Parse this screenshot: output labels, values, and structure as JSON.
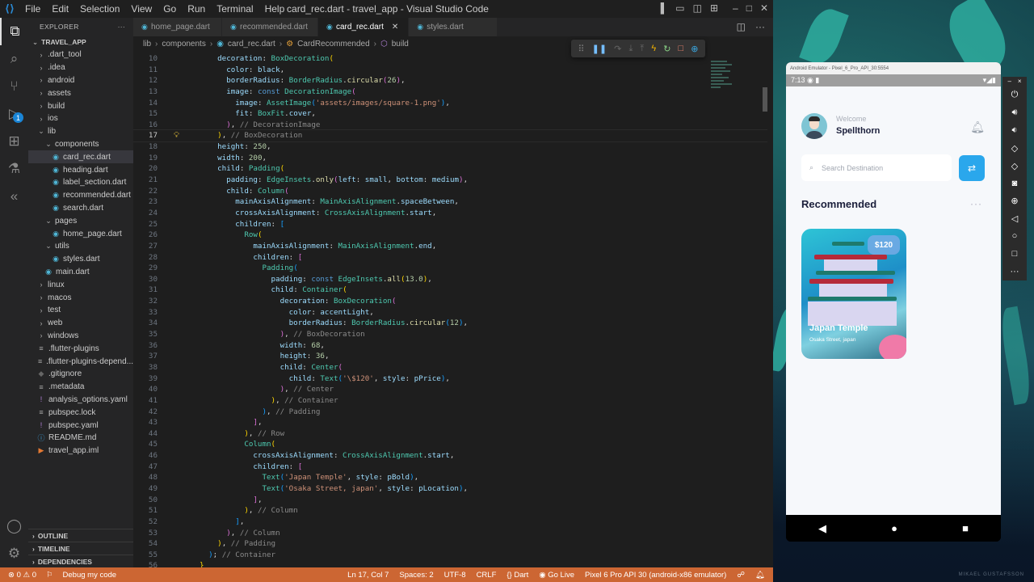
{
  "window": {
    "title": "card_rec.dart - travel_app - Visual Studio Code",
    "menu": [
      "File",
      "Edit",
      "Selection",
      "View",
      "Go",
      "Run",
      "Terminal",
      "Help"
    ]
  },
  "activity_bar": {
    "items": [
      "explorer-icon",
      "search-icon",
      "source-control-icon",
      "run-debug-icon",
      "extensions-icon",
      "testing-icon",
      "flutter-icon"
    ],
    "debug_badge": "1",
    "bottom": [
      "account-icon",
      "manage-gear-icon"
    ]
  },
  "sidebar": {
    "header": "EXPLORER",
    "more": "···",
    "root": "TRAVEL_APP",
    "items": [
      {
        "label": ".dart_tool",
        "type": "folder",
        "depth": 1
      },
      {
        "label": ".idea",
        "type": "folder",
        "depth": 1
      },
      {
        "label": "android",
        "type": "folder",
        "depth": 1
      },
      {
        "label": "assets",
        "type": "folder",
        "depth": 1
      },
      {
        "label": "build",
        "type": "folder",
        "depth": 1
      },
      {
        "label": "ios",
        "type": "folder",
        "depth": 1
      },
      {
        "label": "lib",
        "type": "folder-open",
        "depth": 1
      },
      {
        "label": "components",
        "type": "folder-open",
        "depth": 2
      },
      {
        "label": "card_rec.dart",
        "type": "dart",
        "depth": 3,
        "selected": true
      },
      {
        "label": "heading.dart",
        "type": "dart",
        "depth": 3
      },
      {
        "label": "label_section.dart",
        "type": "dart",
        "depth": 3
      },
      {
        "label": "recommended.dart",
        "type": "dart",
        "depth": 3
      },
      {
        "label": "search.dart",
        "type": "dart",
        "depth": 3
      },
      {
        "label": "pages",
        "type": "folder-open",
        "depth": 2
      },
      {
        "label": "home_page.dart",
        "type": "dart",
        "depth": 3
      },
      {
        "label": "utils",
        "type": "folder-open",
        "depth": 2
      },
      {
        "label": "styles.dart",
        "type": "dart",
        "depth": 3
      },
      {
        "label": "main.dart",
        "type": "dart",
        "depth": 2
      },
      {
        "label": "linux",
        "type": "folder",
        "depth": 1
      },
      {
        "label": "macos",
        "type": "folder",
        "depth": 1
      },
      {
        "label": "test",
        "type": "folder",
        "depth": 1
      },
      {
        "label": "web",
        "type": "folder",
        "depth": 1
      },
      {
        "label": "windows",
        "type": "folder",
        "depth": 1
      },
      {
        "label": ".flutter-plugins",
        "type": "lines",
        "depth": 1
      },
      {
        "label": ".flutter-plugins-depend...",
        "type": "lines",
        "depth": 1
      },
      {
        "label": ".gitignore",
        "type": "git",
        "depth": 1
      },
      {
        "label": ".metadata",
        "type": "lines",
        "depth": 1
      },
      {
        "label": "analysis_options.yaml",
        "type": "yaml",
        "depth": 1
      },
      {
        "label": "pubspec.lock",
        "type": "lines",
        "depth": 1
      },
      {
        "label": "pubspec.yaml",
        "type": "yaml",
        "depth": 1
      },
      {
        "label": "README.md",
        "type": "info",
        "depth": 1
      },
      {
        "label": "travel_app.iml",
        "type": "iml",
        "depth": 1
      }
    ],
    "sections": [
      "OUTLINE",
      "TIMELINE",
      "DEPENDENCIES"
    ]
  },
  "tabs": [
    {
      "label": "home_page.dart",
      "active": false
    },
    {
      "label": "recommended.dart",
      "active": false
    },
    {
      "label": "card_rec.dart",
      "active": true
    },
    {
      "label": "styles.dart",
      "active": false
    }
  ],
  "breadcrumb": [
    "lib",
    "components",
    "card_rec.dart",
    "CardRecommended",
    "build"
  ],
  "debug_toolbar": [
    "drag-handle",
    "pause",
    "step-over",
    "step-into",
    "step-out",
    "hot-reload",
    "hot-restart",
    "stop",
    "devtools"
  ],
  "editor": {
    "current_line": 17,
    "lines": [
      {
        "n": 10,
        "html": "    <span class='k'>decoration</span><span class='p'>: </span><span class='c'>BoxDecoration</span><span class='b1'>(</span>"
      },
      {
        "n": 11,
        "html": "      <span class='k'>color</span><span class='p'>: </span><span class='k'>black</span><span class='p'>,</span>"
      },
      {
        "n": 12,
        "html": "      <span class='k'>borderRadius</span><span class='p'>: </span><span class='c'>BorderRadius</span><span class='p'>.</span><span class='m'>circular</span><span class='b2'>(</span><span class='n'>26</span><span class='b2'>)</span><span class='p'>,</span>"
      },
      {
        "n": 13,
        "html": "      <span class='k'>image</span><span class='p'>: </span><span class='kw'>const</span> <span class='c'>DecorationImage</span><span class='b2'>(</span>"
      },
      {
        "n": 14,
        "html": "        <span class='k'>image</span><span class='p'>: </span><span class='c'>AssetImage</span><span class='b3'>(</span><span class='s'>'assets/images/square-1.png'</span><span class='b3'>)</span><span class='p'>,</span>"
      },
      {
        "n": 15,
        "html": "        <span class='k'>fit</span><span class='p'>: </span><span class='c'>BoxFit</span><span class='p'>.</span><span class='k'>cover</span><span class='p'>,</span>"
      },
      {
        "n": 16,
        "html": "      <span class='b2'>)</span><span class='p'>, </span><span class='cm'>// DecorationImage</span>"
      },
      {
        "n": 17,
        "html": "    <span class='b1'>)</span><span class='p'>, </span><span class='cm'>// BoxDecoration</span>"
      },
      {
        "n": 18,
        "html": "    <span class='k'>height</span><span class='p'>: </span><span class='n'>250</span><span class='p'>,</span>"
      },
      {
        "n": 19,
        "html": "    <span class='k'>width</span><span class='p'>: </span><span class='n'>200</span><span class='p'>,</span>"
      },
      {
        "n": 20,
        "html": "    <span class='k'>child</span><span class='p'>: </span><span class='c'>Padding</span><span class='b1'>(</span>"
      },
      {
        "n": 21,
        "html": "      <span class='k'>padding</span><span class='p'>: </span><span class='c'>EdgeInsets</span><span class='p'>.</span><span class='m'>only</span><span class='b2'>(</span><span class='k'>left</span><span class='p'>: </span><span class='k'>small</span><span class='p'>, </span><span class='k'>bottom</span><span class='p'>: </span><span class='k'>medium</span><span class='b2'>)</span><span class='p'>,</span>"
      },
      {
        "n": 22,
        "html": "      <span class='k'>child</span><span class='p'>: </span><span class='c'>Column</span><span class='b2'>(</span>"
      },
      {
        "n": 23,
        "html": "        <span class='k'>mainAxisAlignment</span><span class='p'>: </span><span class='c'>MainAxisAlignment</span><span class='p'>.</span><span class='k'>spaceBetween</span><span class='p'>,</span>"
      },
      {
        "n": 24,
        "html": "        <span class='k'>crossAxisAlignment</span><span class='p'>: </span><span class='c'>CrossAxisAlignment</span><span class='p'>.</span><span class='k'>start</span><span class='p'>,</span>"
      },
      {
        "n": 25,
        "html": "        <span class='k'>children</span><span class='p'>: </span><span class='b3'>[</span>"
      },
      {
        "n": 26,
        "html": "          <span class='c'>Row</span><span class='b1'>(</span>"
      },
      {
        "n": 27,
        "html": "            <span class='k'>mainAxisAlignment</span><span class='p'>: </span><span class='c'>MainAxisAlignment</span><span class='p'>.</span><span class='k'>end</span><span class='p'>,</span>"
      },
      {
        "n": 28,
        "html": "            <span class='k'>children</span><span class='p'>: </span><span class='b2'>[</span>"
      },
      {
        "n": 29,
        "html": "              <span class='c'>Padding</span><span class='b3'>(</span>"
      },
      {
        "n": 30,
        "html": "                <span class='k'>padding</span><span class='p'>: </span><span class='kw'>const</span> <span class='c'>EdgeInsets</span><span class='p'>.</span><span class='m'>all</span><span class='b1'>(</span><span class='n'>13.0</span><span class='b1'>)</span><span class='p'>,</span>"
      },
      {
        "n": 31,
        "html": "                <span class='k'>child</span><span class='p'>: </span><span class='c'>Container</span><span class='b1'>(</span>"
      },
      {
        "n": 32,
        "html": "                  <span class='k'>decoration</span><span class='p'>: </span><span class='c'>BoxDecoration</span><span class='b2'>(</span>"
      },
      {
        "n": 33,
        "html": "                    <span class='k'>color</span><span class='p'>: </span><span class='k'>accentLight</span><span class='p'>,</span>"
      },
      {
        "n": 34,
        "html": "                    <span class='k'>borderRadius</span><span class='p'>: </span><span class='c'>BorderRadius</span><span class='p'>.</span><span class='m'>circular</span><span class='b3'>(</span><span class='n'>12</span><span class='b3'>)</span><span class='p'>,</span>"
      },
      {
        "n": 35,
        "html": "                  <span class='b2'>)</span><span class='p'>, </span><span class='cm'>// BoxDecoration</span>"
      },
      {
        "n": 36,
        "html": "                  <span class='k'>width</span><span class='p'>: </span><span class='n'>68</span><span class='p'>,</span>"
      },
      {
        "n": 37,
        "html": "                  <span class='k'>height</span><span class='p'>: </span><span class='n'>36</span><span class='p'>,</span>"
      },
      {
        "n": 38,
        "html": "                  <span class='k'>child</span><span class='p'>: </span><span class='c'>Center</span><span class='b2'>(</span>"
      },
      {
        "n": 39,
        "html": "                    <span class='k'>child</span><span class='p'>: </span><span class='c'>Text</span><span class='b3'>(</span><span class='s'>'\\$120'</span><span class='p'>, </span><span class='k'>style</span><span class='p'>: </span><span class='k'>pPrice</span><span class='b3'>)</span><span class='p'>,</span>"
      },
      {
        "n": 40,
        "html": "                  <span class='b2'>)</span><span class='p'>, </span><span class='cm'>// Center</span>"
      },
      {
        "n": 41,
        "html": "                <span class='b1'>)</span><span class='p'>, </span><span class='cm'>// Container</span>"
      },
      {
        "n": 42,
        "html": "              <span class='b3'>)</span><span class='p'>, </span><span class='cm'>// Padding</span>"
      },
      {
        "n": 43,
        "html": "            <span class='b2'>]</span><span class='p'>,</span>"
      },
      {
        "n": 44,
        "html": "          <span class='b1'>)</span><span class='p'>, </span><span class='cm'>// Row</span>"
      },
      {
        "n": 45,
        "html": "          <span class='c'>Column</span><span class='b1'>(</span>"
      },
      {
        "n": 46,
        "html": "            <span class='k'>crossAxisAlignment</span><span class='p'>: </span><span class='c'>CrossAxisAlignment</span><span class='p'>.</span><span class='k'>start</span><span class='p'>,</span>"
      },
      {
        "n": 47,
        "html": "            <span class='k'>children</span><span class='p'>: </span><span class='b2'>[</span>"
      },
      {
        "n": 48,
        "html": "              <span class='c'>Text</span><span class='b3'>(</span><span class='s'>'Japan Temple'</span><span class='p'>, </span><span class='k'>style</span><span class='p'>: </span><span class='k'>pBold</span><span class='b3'>)</span><span class='p'>,</span>"
      },
      {
        "n": 49,
        "html": "              <span class='c'>Text</span><span class='b3'>(</span><span class='s'>'Osaka Street, japan'</span><span class='p'>, </span><span class='k'>style</span><span class='p'>: </span><span class='k'>pLocation</span><span class='b3'>)</span><span class='p'>,</span>"
      },
      {
        "n": 50,
        "html": "            <span class='b2'>]</span><span class='p'>,</span>"
      },
      {
        "n": 51,
        "html": "          <span class='b1'>)</span><span class='p'>, </span><span class='cm'>// Column</span>"
      },
      {
        "n": 52,
        "html": "        <span class='b3'>]</span><span class='p'>,</span>"
      },
      {
        "n": 53,
        "html": "      <span class='b2'>)</span><span class='p'>, </span><span class='cm'>// Column</span>"
      },
      {
        "n": 54,
        "html": "    <span class='b1'>)</span><span class='p'>, </span><span class='cm'>// Padding</span>"
      },
      {
        "n": 55,
        "html": "  <span class='b3'>)</span><span class='p'>; </span><span class='cm'>// Container</span>"
      },
      {
        "n": 56,
        "html": "<span class='b1'>}</span>"
      }
    ]
  },
  "status_bar": {
    "errors": "0",
    "warnings": "0",
    "debug": "Debug my code",
    "position": "Ln 17, Col 7",
    "spaces": "Spaces: 2",
    "encoding": "UTF-8",
    "eol": "CRLF",
    "language": "{} Dart",
    "go_live": "Go Live",
    "device": "Pixel 6 Pro API 30 (android-x86 emulator)"
  },
  "emulator": {
    "window_title": "Android Emulator - Pixel_6_Pro_API_30:5554",
    "time": "7:13",
    "app": {
      "welcome": "Welcome",
      "username": "Spellthorn",
      "search_placeholder": "Search Destination",
      "section_title": "Recommended",
      "more": "···",
      "card": {
        "price": "$120",
        "title": "Japan Temple",
        "location": "Osaka Street, japan"
      }
    },
    "tools": [
      "power-icon",
      "volume-up-icon",
      "volume-down-icon",
      "rotate-left-icon",
      "rotate-right-icon",
      "screenshot-icon",
      "zoom-icon",
      "back-icon",
      "home-icon",
      "overview-icon",
      "more-icon"
    ]
  },
  "watermark": "MIKAEL GUSTAFSSON"
}
